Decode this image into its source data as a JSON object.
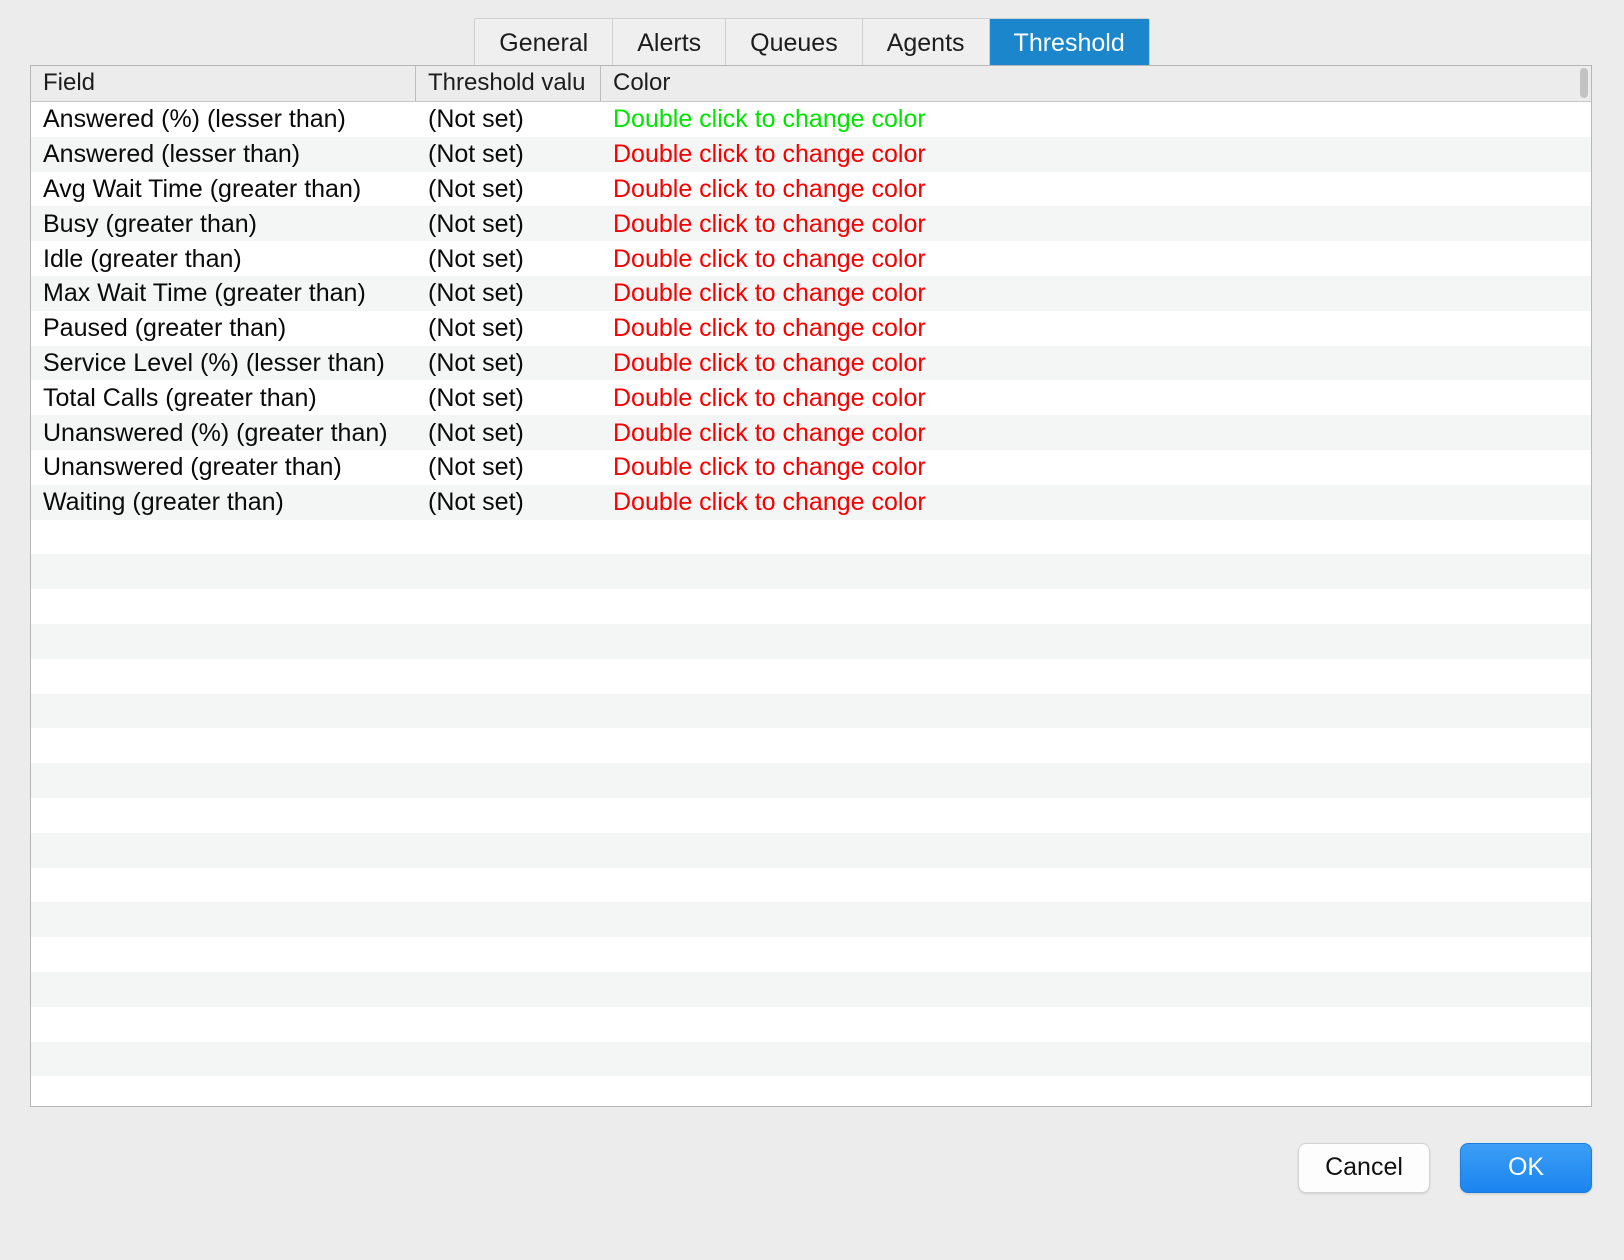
{
  "tabs": [
    {
      "label": "General",
      "selected": false
    },
    {
      "label": "Alerts",
      "selected": false
    },
    {
      "label": "Queues",
      "selected": false
    },
    {
      "label": "Agents",
      "selected": false
    },
    {
      "label": "Threshold",
      "selected": true
    }
  ],
  "table": {
    "columns": [
      {
        "key": "field",
        "label": "Field"
      },
      {
        "key": "value",
        "label": "Threshold valu"
      },
      {
        "key": "color",
        "label": "Color"
      }
    ],
    "rows": [
      {
        "field": "Answered (%) (lesser than)",
        "value": "(Not set)",
        "color_text": "Double click to change color",
        "color": "#00e400"
      },
      {
        "field": "Answered (lesser than)",
        "value": "(Not set)",
        "color_text": "Double click to change color",
        "color": "#f60000"
      },
      {
        "field": "Avg Wait Time (greater than)",
        "value": "(Not set)",
        "color_text": "Double click to change color",
        "color": "#f60000"
      },
      {
        "field": "Busy (greater than)",
        "value": "(Not set)",
        "color_text": "Double click to change color",
        "color": "#f60000"
      },
      {
        "field": "Idle (greater than)",
        "value": "(Not set)",
        "color_text": "Double click to change color",
        "color": "#f60000"
      },
      {
        "field": "Max Wait Time (greater than)",
        "value": "(Not set)",
        "color_text": "Double click to change color",
        "color": "#f60000"
      },
      {
        "field": "Paused (greater than)",
        "value": "(Not set)",
        "color_text": "Double click to change color",
        "color": "#f60000"
      },
      {
        "field": "Service Level (%) (lesser than)",
        "value": "(Not set)",
        "color_text": "Double click to change color",
        "color": "#f60000"
      },
      {
        "field": "Total Calls (greater than)",
        "value": "(Not set)",
        "color_text": "Double click to change color",
        "color": "#f60000"
      },
      {
        "field": "Unanswered (%) (greater than)",
        "value": "(Not set)",
        "color_text": "Double click to change color",
        "color": "#f60000"
      },
      {
        "field": "Unanswered (greater than)",
        "value": "(Not set)",
        "color_text": "Double click to change color",
        "color": "#f60000"
      },
      {
        "field": "Waiting (greater than)",
        "value": "(Not set)",
        "color_text": "Double click to change color",
        "color": "#f60000"
      }
    ],
    "empty_row_count": 17
  },
  "footer": {
    "cancel_label": "Cancel",
    "ok_label": "OK"
  },
  "theme": {
    "selected_tab_bg": "#1b86cb",
    "ok_button_bg": "#2b90f2",
    "window_bg": "#ececec",
    "row_alt_bg": "#f4f5f5"
  }
}
